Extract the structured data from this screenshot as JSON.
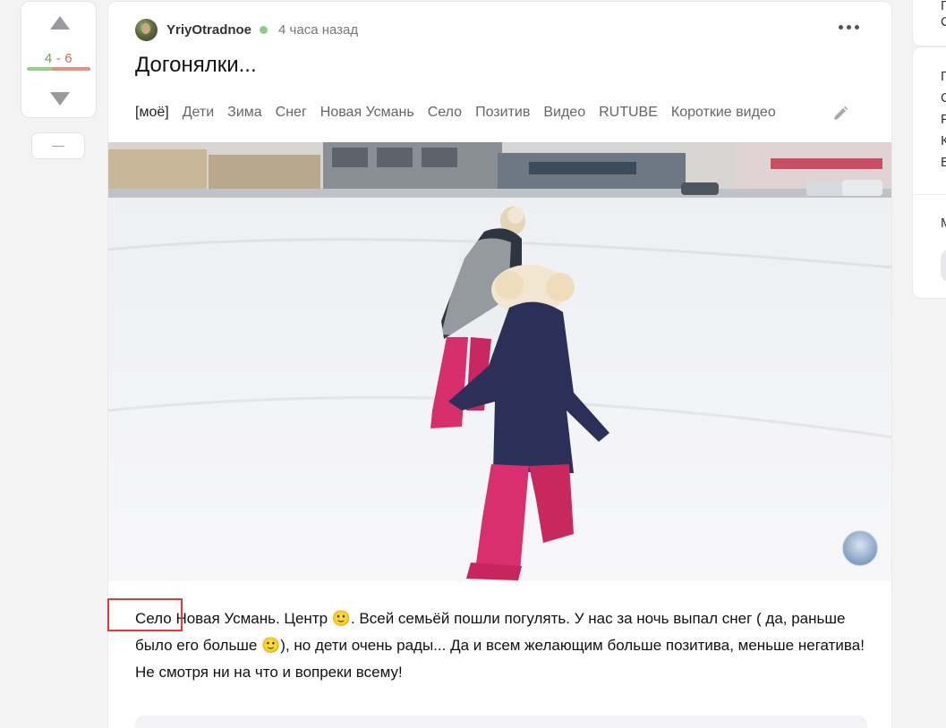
{
  "vote": {
    "plus": "4",
    "separator": "-",
    "minus": "6",
    "plus_count": 4,
    "minus_count": 6,
    "save_label": "—"
  },
  "post": {
    "author": "YriyOtradnoe",
    "time": "4 часа назад",
    "title": "Догонялки...",
    "tags": [
      "[моё]",
      "Дети",
      "Зима",
      "Снег",
      "Новая Усмань",
      "Село",
      "Позитив",
      "Видео",
      "RUTUBE",
      "Короткие видео"
    ],
    "text": "Село Новая Усмань. Центр 🙂. Всей семьёй пошли погулять. У нас за ночь выпал снег ( да, раньше было его больше 🙂), но дети очень рады... Да и всем желающим больше позитива, меньше негатива! Не смотря ни на что и вопреки всему!"
  },
  "sidebar": {
    "letters_top": [
      "Г",
      "С"
    ],
    "letters_main": [
      "П",
      "С",
      "Р",
      "К",
      "В"
    ],
    "letter_lower": "М"
  },
  "colors": {
    "plus": "#6aa84f",
    "minus": "#cc6e5b",
    "online": "#8ccc86",
    "highlight": "#e53935"
  }
}
